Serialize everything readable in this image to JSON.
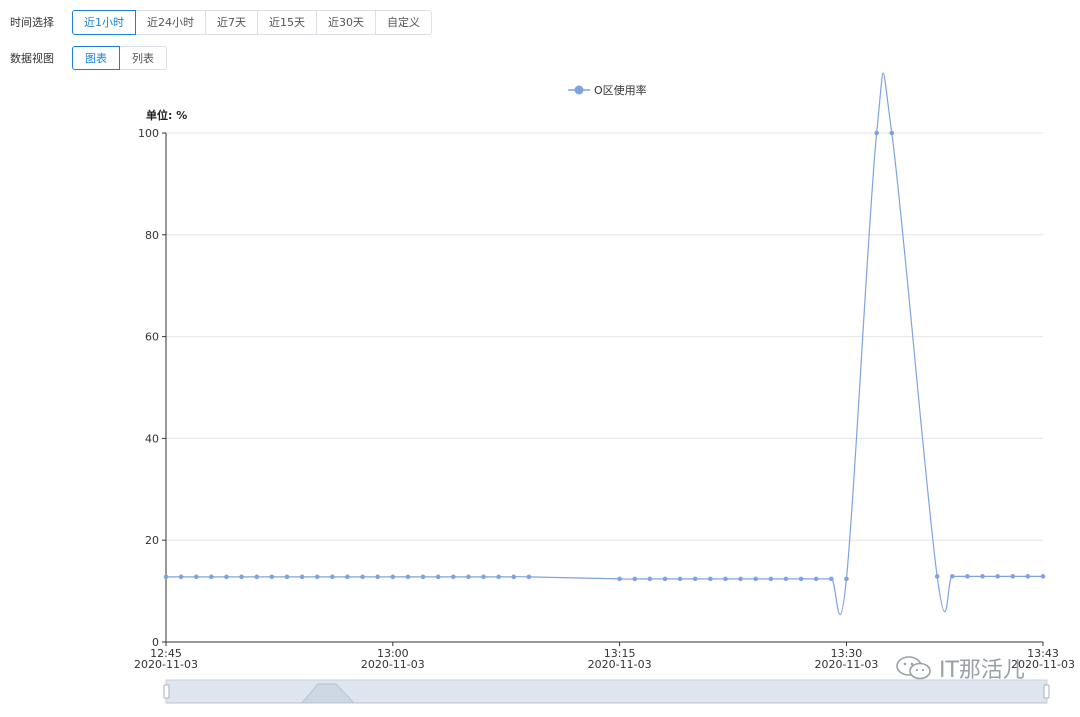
{
  "time_select": {
    "label": "时间选择",
    "options": [
      "近1小时",
      "近24小时",
      "近7天",
      "近15天",
      "近30天",
      "自定义"
    ],
    "active_index": 0
  },
  "data_view": {
    "label": "数据视图",
    "options": [
      "图表",
      "列表"
    ],
    "active_index": 0
  },
  "watermark": {
    "text": "IT那活儿"
  },
  "colors": {
    "accent": "#1a7fd8",
    "series": "#7ea3e0",
    "grid": "#e4e4e4"
  },
  "chart_data": {
    "type": "line",
    "legend": [
      "O区使用率"
    ],
    "legend_position": "top-center",
    "unit_label": "单位: %",
    "y_ticks": [
      "0",
      "20",
      "40",
      "60",
      "80",
      "100"
    ],
    "ylim": [
      0,
      100
    ],
    "xlim": [
      "12:45",
      "13:43"
    ],
    "x_ticks": [
      {
        "time": "12:45",
        "date": "2020-11-03"
      },
      {
        "time": "13:00",
        "date": "2020-11-03"
      },
      {
        "time": "13:15",
        "date": "2020-11-03"
      },
      {
        "time": "13:30",
        "date": "2020-11-03"
      },
      {
        "time": "13:43",
        "date": "2020-11-03"
      }
    ],
    "grid": true,
    "series": [
      {
        "name": "O区使用率",
        "points": [
          [
            "12:45",
            12.8
          ],
          [
            "12:46",
            12.8
          ],
          [
            "12:47",
            12.8
          ],
          [
            "12:48",
            12.8
          ],
          [
            "12:49",
            12.8
          ],
          [
            "12:50",
            12.8
          ],
          [
            "12:51",
            12.8
          ],
          [
            "12:52",
            12.8
          ],
          [
            "12:53",
            12.8
          ],
          [
            "12:54",
            12.8
          ],
          [
            "12:55",
            12.8
          ],
          [
            "12:56",
            12.8
          ],
          [
            "12:57",
            12.8
          ],
          [
            "12:58",
            12.8
          ],
          [
            "12:59",
            12.8
          ],
          [
            "13:00",
            12.8
          ],
          [
            "13:01",
            12.8
          ],
          [
            "13:02",
            12.8
          ],
          [
            "13:03",
            12.8
          ],
          [
            "13:04",
            12.8
          ],
          [
            "13:05",
            12.8
          ],
          [
            "13:06",
            12.8
          ],
          [
            "13:07",
            12.8
          ],
          [
            "13:08",
            12.8
          ],
          [
            "13:09",
            12.8
          ],
          [
            "13:15",
            12.4
          ],
          [
            "13:16",
            12.4
          ],
          [
            "13:17",
            12.4
          ],
          [
            "13:18",
            12.4
          ],
          [
            "13:19",
            12.4
          ],
          [
            "13:20",
            12.4
          ],
          [
            "13:21",
            12.4
          ],
          [
            "13:22",
            12.4
          ],
          [
            "13:23",
            12.4
          ],
          [
            "13:24",
            12.4
          ],
          [
            "13:25",
            12.4
          ],
          [
            "13:26",
            12.4
          ],
          [
            "13:27",
            12.4
          ],
          [
            "13:28",
            12.4
          ],
          [
            "13:29",
            12.4
          ],
          [
            "13:30",
            12.4
          ],
          [
            "13:32",
            100
          ],
          [
            "13:33",
            100
          ],
          [
            "13:36",
            12.9
          ],
          [
            "13:37",
            12.9
          ],
          [
            "13:38",
            12.9
          ],
          [
            "13:39",
            12.9
          ],
          [
            "13:40",
            12.9
          ],
          [
            "13:41",
            12.9
          ],
          [
            "13:42",
            12.9
          ],
          [
            "13:43",
            12.9
          ]
        ]
      }
    ],
    "data_zoom": {
      "start": 0,
      "end": 100
    }
  }
}
